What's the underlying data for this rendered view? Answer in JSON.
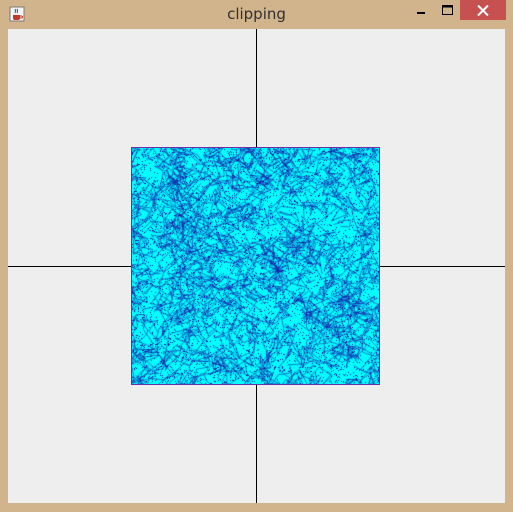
{
  "window": {
    "title": "clipping",
    "controls": {
      "minimize_icon": "minimize-icon",
      "maximize_icon": "maximize-icon",
      "close_icon": "close-icon"
    },
    "app_icon": "java-cup-icon"
  },
  "canvas": {
    "background_color": "#eeeeee",
    "axis_color": "#000000",
    "clip_region": {
      "fill_color": "#00ffff",
      "line_color": "#1a1aa8",
      "border_color": "#6b2fa8"
    }
  },
  "colors": {
    "frame": "#d2b48c",
    "close_button": "#c75050"
  }
}
